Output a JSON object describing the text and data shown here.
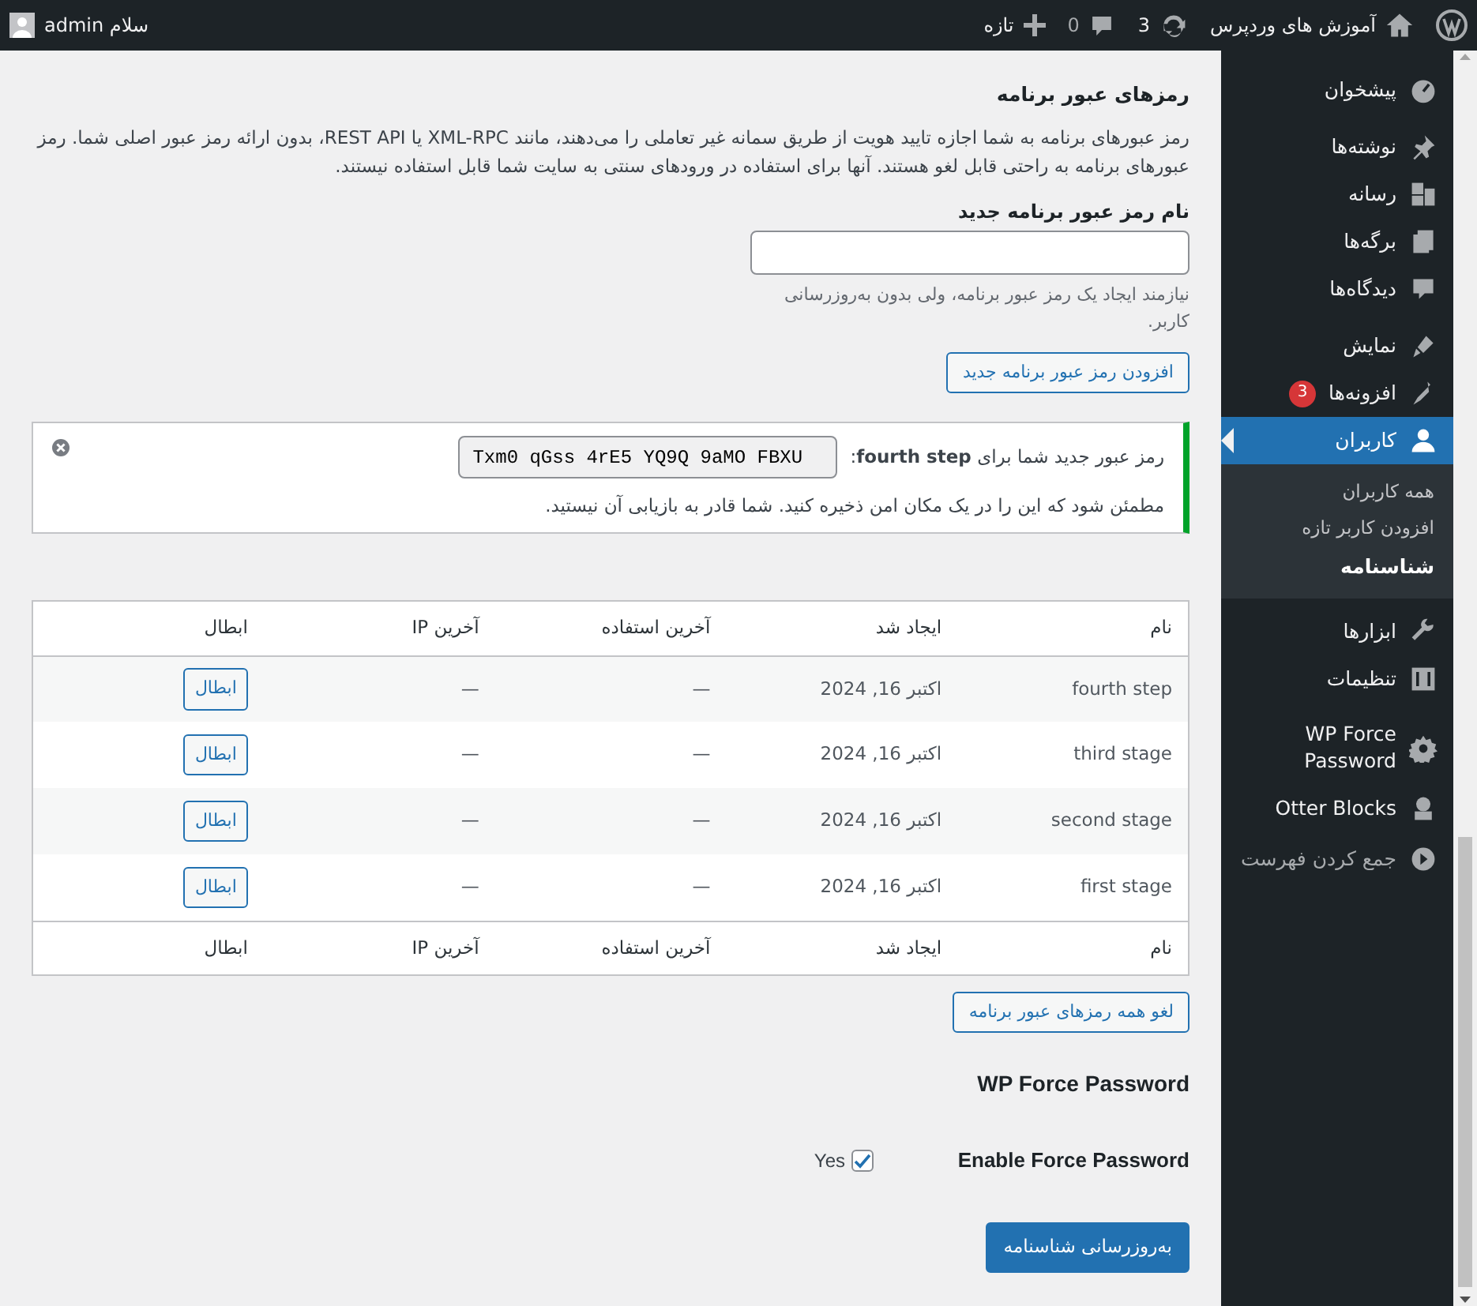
{
  "admin_bar": {
    "site_title": "آموزش های وردپرس",
    "updates_count": "3",
    "comments_count": "0",
    "new_label": "تازه",
    "greeting": "سلام admin"
  },
  "sidebar": {
    "items": [
      {
        "label": "پیشخوان",
        "selected": false
      },
      {
        "label": "نوشته‌ها",
        "selected": false
      },
      {
        "label": "رسانه",
        "selected": false
      },
      {
        "label": "برگه‌ها",
        "selected": false
      },
      {
        "label": "دیدگاه‌ها",
        "selected": false
      },
      {
        "label": "نمایش",
        "selected": false
      },
      {
        "label": "افزونه‌ها",
        "selected": false,
        "badge": "3"
      },
      {
        "label": "کاربران",
        "selected": true,
        "children": [
          {
            "label": "همه کاربران",
            "selected": false
          },
          {
            "label": "افزودن کاربر تازه",
            "selected": false
          },
          {
            "label": "شناسنامه",
            "selected": true
          }
        ]
      },
      {
        "label": "ابزارها",
        "selected": false
      },
      {
        "label": "تنظیمات",
        "selected": false
      },
      {
        "label": "WP Force Password",
        "selected": false
      },
      {
        "label": "Otter Blocks",
        "selected": false
      }
    ],
    "collapse_label": "جمع کردن فهرست"
  },
  "app_passwords": {
    "title": "رمزهای عبور برنامه",
    "description": "رمز عبورهای برنامه به شما اجازه تایید هویت از طریق سمانه غیر تعاملی را می‌دهند، مانند XML-RPC یا REST API، بدون ارائه رمز عبور اصلی شما. رمز عبورهای برنامه به راحتی قابل لغو هستند. آنها برای استفاده در ورودهای سنتی به سایت شما قابل استفاده نیستند.",
    "new_name_label": "نام رمز عبور برنامه جدید",
    "new_name_hint": "نیازمند ایجاد یک رمز عبور برنامه، ولی بدون به‌روزرسانی کاربر.",
    "add_button": "افزودن رمز عبور برنامه جدید",
    "notice": {
      "message": "رمز عبور جدید شما برای **fourth step**:",
      "password": "Txm0 qGss 4rE5 YQ9Q 9aMO FBXU",
      "warning": "مطمئن شود که این را در یک مکان امن ذخیره کنید. شما قادر به بازیابی آن نیستید."
    },
    "table": {
      "columns": [
        "نام",
        "ایجاد شد",
        "آخرین استفاده",
        "آخرین IP",
        "ابطال"
      ],
      "rows": [
        {
          "name": "fourth step",
          "created": "اکتبر 16, 2024",
          "last_used": "—",
          "last_ip": "—",
          "revoke": "ابطال"
        },
        {
          "name": "third stage",
          "created": "اکتبر 16, 2024",
          "last_used": "—",
          "last_ip": "—",
          "revoke": "ابطال"
        },
        {
          "name": "second stage",
          "created": "اکتبر 16, 2024",
          "last_used": "—",
          "last_ip": "—",
          "revoke": "ابطال"
        },
        {
          "name": "first stage",
          "created": "اکتبر 16, 2024",
          "last_used": "—",
          "last_ip": "—",
          "revoke": "ابطال"
        }
      ],
      "footer_columns": [
        "نام",
        "ایجاد شد",
        "آخرین استفاده",
        "آخرین IP",
        "ابطال"
      ]
    },
    "revoke_all_button": "لغو همه رمزهای عبور برنامه"
  },
  "force_password": {
    "title": "WP Force Password",
    "field_label": "Enable Force Password",
    "checkbox_label": "Yes",
    "checked": true
  },
  "submit_button": "به‌روزرسانی شناسنامه"
}
